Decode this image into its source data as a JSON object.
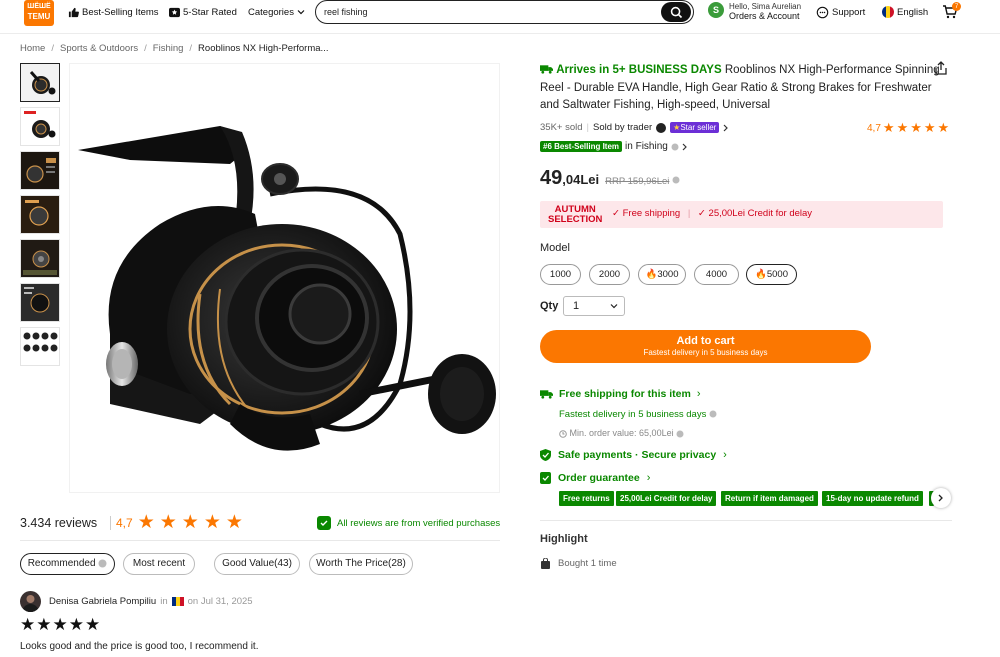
{
  "header": {
    "logo_line1": "ШЁШЁ",
    "logo_line2": "TEMU",
    "nav": [
      "Best-Selling Items",
      "5-Star Rated",
      "Categories"
    ],
    "search_value": "reel fishing",
    "avatar_initial": "S",
    "greeting": "Hello, Sima Aurelian",
    "account_label": "Orders & Account",
    "support": "Support",
    "language": "English",
    "cart_count": "7"
  },
  "breadcrumb": [
    "Home",
    "Sports & Outdoors",
    "Fishing",
    "Rooblinos NX High-Performa..."
  ],
  "product": {
    "arrives": "Arrives in 5+ BUSINESS DAYS",
    "title": "Rooblinos NX High-Performance Spinning Reel - Durable EVA Handle, High Gear Ratio & Strong Brakes for Freshwater and Saltwater Fishing, High-speed, Universal",
    "sold": "35K+ sold",
    "sold_by": "Sold by trader",
    "star_seller": "Star seller",
    "rating": "4,7",
    "bestselling_badge": "#6 Best-Selling Item",
    "in_category": "in Fishing",
    "price_int": "49",
    "price_dec": ",04Lei",
    "rrp": "RRP 159,96Lei",
    "promo_title1": "AUTUMN",
    "promo_title2": "SELECTION",
    "promo_free_shipping": "Free shipping",
    "promo_credit": "25,00Lei Credit for delay",
    "model_label": "Model",
    "models": [
      {
        "label": "1000",
        "hot": false,
        "selected": false
      },
      {
        "label": "2000",
        "hot": false,
        "selected": false
      },
      {
        "label": "3000",
        "hot": true,
        "selected": false
      },
      {
        "label": "4000",
        "hot": false,
        "selected": false
      },
      {
        "label": "5000",
        "hot": true,
        "selected": true
      }
    ],
    "qty_label": "Qty",
    "qty_value": "1",
    "cart_button": "Add to cart",
    "cart_sub": "Fastest delivery in 5 business days",
    "free_ship_title": "Free shipping for this item",
    "fastest_delivery": "Fastest delivery in 5 business days",
    "min_order": "Min. order value: 65,00Lei",
    "safe_payments": "Safe payments · Secure privacy",
    "order_guarantee": "Order guarantee",
    "guarantee_chips": [
      "Free returns",
      "25,00Lei Credit for delay",
      "Return if item damaged",
      "15-day no update refund"
    ],
    "highlight_title": "Highlight",
    "highlight_item": "Bought 1 time"
  },
  "reviews": {
    "count": "3.434 reviews",
    "rating": "4,7",
    "verified": "All reviews are from verified purchases",
    "filters": [
      "Recommended",
      "Most recent",
      "Good Value(43)",
      "Worth The Price(28)"
    ],
    "reviewer": "Denisa Gabriela Pompiliu",
    "in_word": "in",
    "date": "on Jul 31, 2025",
    "stars": 5,
    "text": "Looks good and the price is good too, I recommend it."
  },
  "colors": {
    "accent": "#fb7701",
    "green": "#0a8800",
    "promo_bg": "#fde7ea",
    "promo_red": "#d0021b"
  }
}
